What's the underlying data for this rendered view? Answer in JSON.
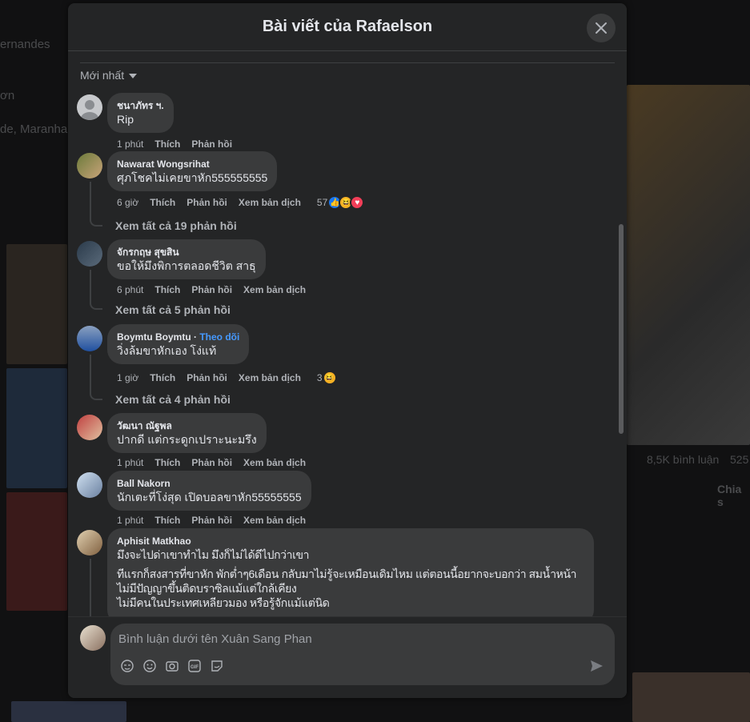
{
  "background": {
    "texts": [
      "ernandes",
      "ơn",
      "de, Maranha",
      "8,5K bình luận",
      "525",
      "Chia s"
    ]
  },
  "modal": {
    "title": "Bài viết của Rafaelson",
    "sort_label": "Mới nhất",
    "comments": [
      {
        "name": "ชนาภัทร ฯ.",
        "text": "Rip",
        "time": "1 phút",
        "like": "Thích",
        "reply": "Phản hồi"
      },
      {
        "name": "Nawarat Wongsrihat",
        "text": "ศุภโชคไม่เคยขาหัก555555555",
        "time": "6 giờ",
        "like": "Thích",
        "reply": "Phản hồi",
        "translate": "Xem bản dịch",
        "reaction_count": "57",
        "reactions": [
          "like",
          "haha",
          "love"
        ],
        "view_replies": "Xem tất cả 19 phản hồi"
      },
      {
        "name": "จักรกฤษ สุขสิน",
        "text": "ขอให้มึงพิการตลอดชีวิต สาธุ",
        "time": "6 phút",
        "like": "Thích",
        "reply": "Phản hồi",
        "translate": "Xem bản dịch",
        "view_replies": "Xem tất cả 5 phản hồi"
      },
      {
        "name": "Boymtu Boymtu",
        "follow": "Theo dõi",
        "text": "วิ่งล้มขาหักเอง โง่แท้",
        "time": "1 giờ",
        "like": "Thích",
        "reply": "Phản hồi",
        "translate": "Xem bản dịch",
        "reaction_count": "3",
        "reactions": [
          "haha"
        ],
        "view_replies": "Xem tất cả 4 phản hồi"
      },
      {
        "name": "วัฒนา ณัฐพล",
        "text": "ปากดี แต่กระดูกเปราะนะมรึง",
        "time": "1 phút",
        "like": "Thích",
        "reply": "Phản hồi",
        "translate": "Xem bản dịch"
      },
      {
        "name": "Ball Nakorn",
        "text": "นักเตะที่โง่สุด เปิดบอลขาหัก55555555",
        "time": "1 phút",
        "like": "Thích",
        "reply": "Phản hồi",
        "translate": "Xem bản dịch"
      },
      {
        "name": "Aphisit Matkhao",
        "text": "มึงจะไปด่าเขาทำไม มึงก็ไม่ได้ดีไปกว่าเขา",
        "text2": "ทีแรกก็สงสารที่ขาหัก พักต่ำๆ6เดือน กลับมาไม่รู้จะเหมือนเดิมไหม แต่ตอนนี้อยากจะบอกว่า สมน้ำหน้า",
        "text3": "ไม่มีปัญญาขึ้นติดบราซิลแม้แต่ใกล้เคียง",
        "text4": "ไม่มีคนในประเทศเหลียวมอง หรือรู้จักแม้แต่นิด"
      }
    ],
    "composer": {
      "placeholder": "Bình luận dưới tên Xuân Sang Phan",
      "tools": [
        "avatar-sticker",
        "emoji",
        "camera",
        "gif",
        "sticker"
      ]
    }
  },
  "colors": {
    "modal_bg": "#242526",
    "bubble_bg": "#3a3b3c",
    "link": "#4599ff",
    "like": "#1877f2",
    "love": "#f33e58",
    "haha": "#f7b125"
  }
}
